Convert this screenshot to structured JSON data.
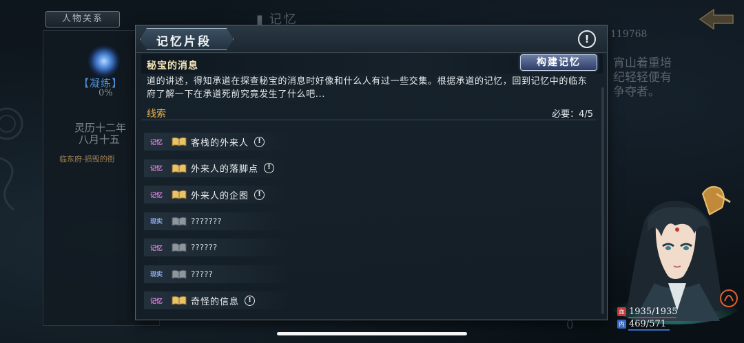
{
  "background": {
    "relations_tab": "人物关系",
    "memory_title": "记忆",
    "condense_label": "【凝练】",
    "condense_percent": "0%",
    "date_line1": "灵历十二年",
    "date_line2": "八月十五",
    "location": "临东府-损毁的街",
    "number": "119768",
    "right_text": "宵山着重培纪轻轻便有争夺者。",
    "bottom_number": "0"
  },
  "dialog": {
    "title": "记忆片段",
    "info_glyph": "!",
    "subtitle": "秘宝的消息",
    "build_button": "构建记忆",
    "description": "道的讲述，得知承道在探查秘宝的消息时好像和什么人有过一些交集。根据承道的记忆，回到记忆中的临东府了解一下在承道死前究竟发生了什么吧...",
    "section_label": "线索",
    "required_label": "必要：4/5"
  },
  "clues": [
    {
      "type": "记忆",
      "kind": "memory",
      "text": "客栈的外来人",
      "known": true
    },
    {
      "type": "记忆",
      "kind": "memory",
      "text": "外来人的落脚点",
      "known": true
    },
    {
      "type": "记忆",
      "kind": "memory",
      "text": "外来人的企图",
      "known": true
    },
    {
      "type": "现实",
      "kind": "reality",
      "text": "???????",
      "known": false
    },
    {
      "type": "记忆",
      "kind": "memory",
      "text": "??????",
      "known": false
    },
    {
      "type": "现实",
      "kind": "reality",
      "text": "?????",
      "known": false
    },
    {
      "type": "记忆",
      "kind": "memory",
      "text": "奇怪的信息",
      "known": true
    }
  ],
  "character": {
    "hp": "1935/1935",
    "mp": "469/571",
    "hp_icon": "血",
    "mp_icon": "内",
    "hp_color": "#c23a3a",
    "mp_color": "#3a6ac2"
  },
  "colors": {
    "accent_gold": "#e9b24a",
    "memory_tag": "#d87ed6",
    "reality_tag": "#8eb0ec"
  }
}
